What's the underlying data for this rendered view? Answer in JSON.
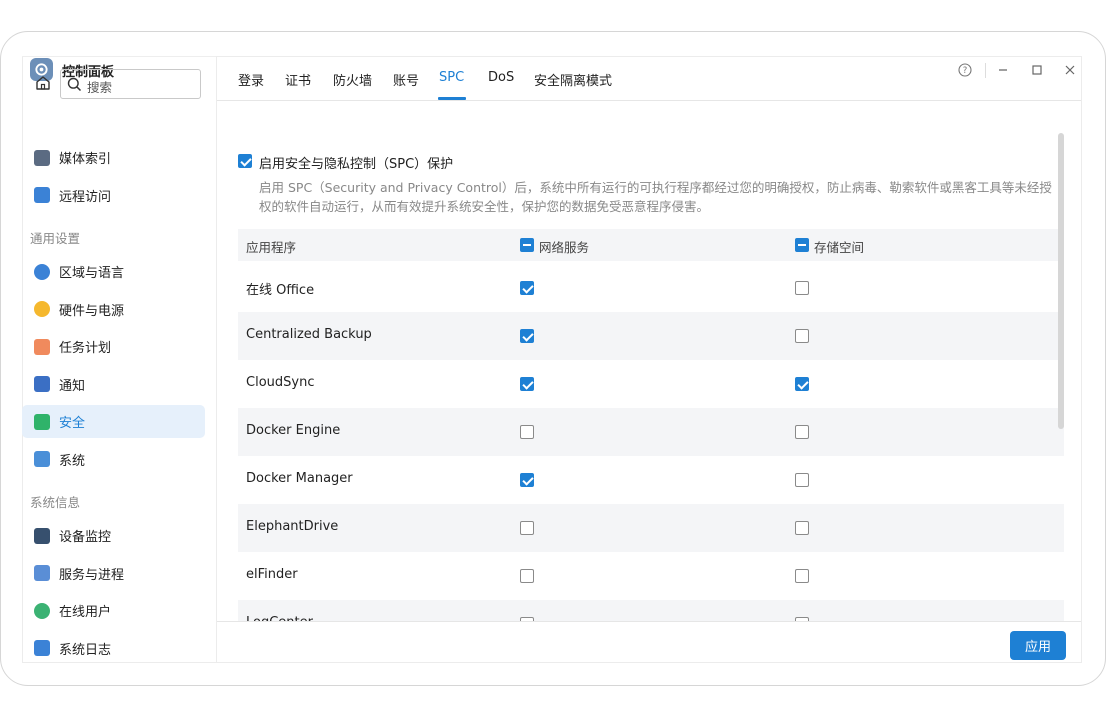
{
  "app": {
    "title": "控制面板"
  },
  "window_controls": {
    "help": "?",
    "minimize": "–",
    "maximize": "□",
    "close": "✕"
  },
  "search": {
    "placeholder": "搜索"
  },
  "sidebar": {
    "items_top": [
      {
        "label": "媒体索引",
        "icon": "media-index-icon",
        "color": "#5b6b82"
      },
      {
        "label": "远程访问",
        "icon": "remote-access-icon",
        "color": "#3b82d6"
      }
    ],
    "section_general": "通用设置",
    "items_general": [
      {
        "label": "区域与语言",
        "icon": "globe-icon",
        "color": "#3b82d6"
      },
      {
        "label": "硬件与电源",
        "icon": "bulb-icon",
        "color": "#f5b82e"
      },
      {
        "label": "任务计划",
        "icon": "calendar-icon",
        "color": "#f08a5d"
      },
      {
        "label": "通知",
        "icon": "notification-icon",
        "color": "#3b6fc4"
      },
      {
        "label": "安全",
        "icon": "shield-icon",
        "color": "#2fb36a",
        "active": true
      },
      {
        "label": "系统",
        "icon": "monitor-icon",
        "color": "#4a8fd8"
      }
    ],
    "section_info": "系统信息",
    "items_info": [
      {
        "label": "设备监控",
        "icon": "device-monitor-icon",
        "color": "#37506e"
      },
      {
        "label": "服务与进程",
        "icon": "services-icon",
        "color": "#5a8ed6"
      },
      {
        "label": "在线用户",
        "icon": "online-user-icon",
        "color": "#3bb273"
      },
      {
        "label": "系统日志",
        "icon": "system-log-icon",
        "color": "#3b82d6"
      }
    ]
  },
  "tabs": [
    "登录",
    "证书",
    "防火墙",
    "账号",
    "SPC",
    "DoS",
    "安全隔离模式"
  ],
  "active_tab": "SPC",
  "spc": {
    "enable_label": "启用安全与隐私控制（SPC）保护",
    "enabled": true,
    "description": "启用 SPC（Security and Privacy Control）后，系统中所有运行的可执行程序都经过您的明确授权，防止病毒、勒索软件或黑客工具等未经授权的软件自动运行，从而有效提升系统安全性，保护您的数据免受恶意程序侵害。"
  },
  "table": {
    "headers": {
      "app": "应用程序",
      "network": "网络服务",
      "storage": "存储空间"
    },
    "rows": [
      {
        "name": "在线 Office",
        "network": true,
        "storage": false
      },
      {
        "name": "Centralized Backup",
        "network": true,
        "storage": false
      },
      {
        "name": "CloudSync",
        "network": true,
        "storage": true
      },
      {
        "name": "Docker Engine",
        "network": false,
        "storage": false
      },
      {
        "name": "Docker Manager",
        "network": true,
        "storage": false
      },
      {
        "name": "ElephantDrive",
        "network": false,
        "storage": false
      },
      {
        "name": "elFinder",
        "network": false,
        "storage": false
      },
      {
        "name": "LogCenter",
        "network": false,
        "storage": false
      }
    ]
  },
  "footer": {
    "apply_label": "应用"
  }
}
